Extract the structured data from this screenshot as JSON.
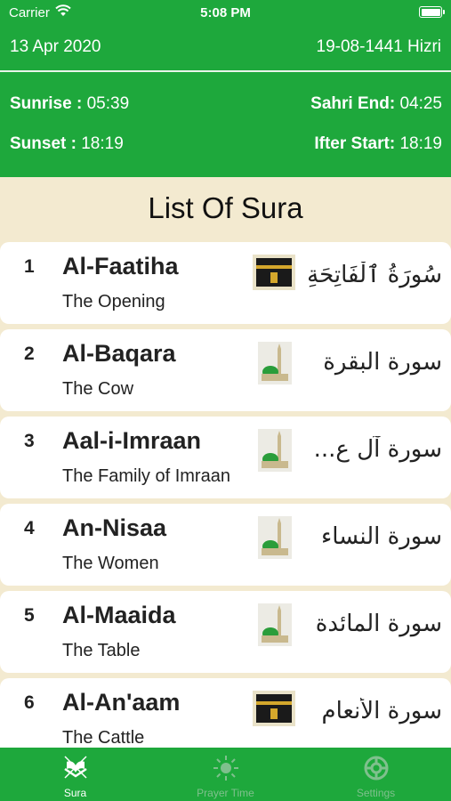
{
  "status_bar": {
    "carrier": "Carrier",
    "time": "5:08 PM"
  },
  "header": {
    "date_gregorian": "13 Apr 2020",
    "date_hijri": "19-08-1441 Hizri",
    "sunrise_label": "Sunrise :",
    "sunrise_time": "05:39",
    "sunset_label": "Sunset :",
    "sunset_time": "18:19",
    "sahri_label": "Sahri End:",
    "sahri_time": "04:25",
    "ifter_label": "Ifter Start:",
    "ifter_time": "18:19"
  },
  "list_title": "List Of Sura",
  "suras": [
    {
      "number": "1",
      "name": "Al-Faatiha",
      "meaning": "The Opening",
      "arabic": "سُورَةُ ٱلْفَاتِحَةِ",
      "icon": "kaaba-icon"
    },
    {
      "number": "2",
      "name": "Al-Baqara",
      "meaning": "The Cow",
      "arabic": "سورة البقرة",
      "icon": "mosque-icon"
    },
    {
      "number": "3",
      "name": "Aal-i-Imraan",
      "meaning": "The Family of Imraan",
      "arabic": "سورة آل ع...",
      "icon": "mosque-icon"
    },
    {
      "number": "4",
      "name": "An-Nisaa",
      "meaning": "The Women",
      "arabic": "سورة النساء",
      "icon": "mosque-icon"
    },
    {
      "number": "5",
      "name": "Al-Maaida",
      "meaning": "The Table",
      "arabic": "سورة المائدة",
      "icon": "mosque-icon"
    },
    {
      "number": "6",
      "name": "Al-An'aam",
      "meaning": "The Cattle",
      "arabic": "سورة الأنعام",
      "icon": "kaaba-icon"
    }
  ],
  "tabs": [
    {
      "label": "Sura",
      "icon": "quran-icon",
      "active": true
    },
    {
      "label": "Prayer Time",
      "icon": "sun-icon",
      "active": false
    },
    {
      "label": "Settings",
      "icon": "gear-icon",
      "active": false
    }
  ],
  "colors": {
    "header_green": "#1ea83c",
    "background_cream": "#f3ead0",
    "tab_inactive": "#7fc08d"
  }
}
